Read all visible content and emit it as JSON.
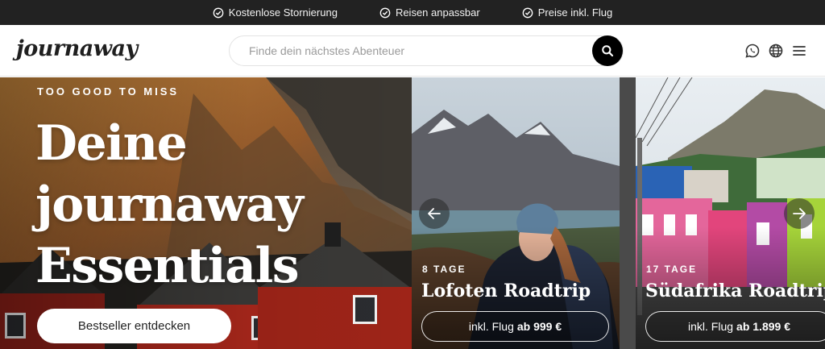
{
  "topbar": {
    "items": [
      {
        "label": "Kostenlose Stornierung",
        "icon": "check-circle-icon"
      },
      {
        "label": "Reisen anpassbar",
        "icon": "check-circle-icon"
      },
      {
        "label": "Preise inkl. Flug",
        "icon": "check-circle-icon"
      }
    ]
  },
  "header": {
    "logo": "journaway",
    "search": {
      "placeholder": "Finde dein nächstes Abenteuer",
      "value": ""
    },
    "icons": [
      "search-icon",
      "whatsapp-icon",
      "globe-icon",
      "menu-icon"
    ]
  },
  "hero": {
    "eyebrow": "TOO GOOD TO MISS",
    "title_lines": [
      "Deine",
      "journaway",
      "Essentials"
    ],
    "cta": "Bestseller entdecken"
  },
  "cards": [
    {
      "days": "8 TAGE",
      "title": "Lofoten Roadtrip",
      "price_prefix": "inkl. Flug",
      "price": "ab 999 €"
    },
    {
      "days": "17 TAGE",
      "title": "Südafrika Roadtrip",
      "price_prefix": "inkl. Flug",
      "price": "ab 1.899 €"
    }
  ],
  "carousel": {
    "prev": "arrow-left-icon",
    "next": "arrow-right-icon"
  }
}
